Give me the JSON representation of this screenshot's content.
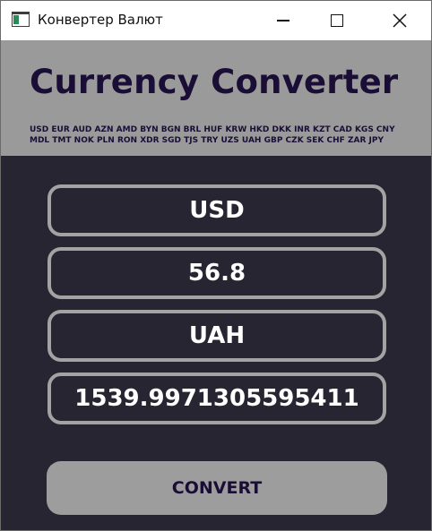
{
  "window": {
    "title": "Конвертер Валют",
    "icon": "app-window-icon"
  },
  "controls": {
    "minimize": "minimize-icon",
    "maximize": "maximize-icon",
    "close": "close-icon"
  },
  "header": {
    "title": "Currency Converter",
    "currencies": "USD EUR AUD AZN AMD BYN BGN BRL HUF KRW HKD DKK INR KZT CAD KGS CNY MDL TMT NOK PLN RON XDR SGD TJS TRY UZS UAH GBP CZK SEK CHF ZAR JPY"
  },
  "form": {
    "from_currency": "USD",
    "amount": "56.8",
    "to_currency": "UAH",
    "result": "1539.9971305595411"
  },
  "convert_button": {
    "label": "CONVERT"
  },
  "colors": {
    "background": "#262531",
    "header_background": "#9a9a9a",
    "heading_text": "#1b0e36",
    "field_border": "#a3a3a3",
    "button_background": "#9d9d9d"
  }
}
